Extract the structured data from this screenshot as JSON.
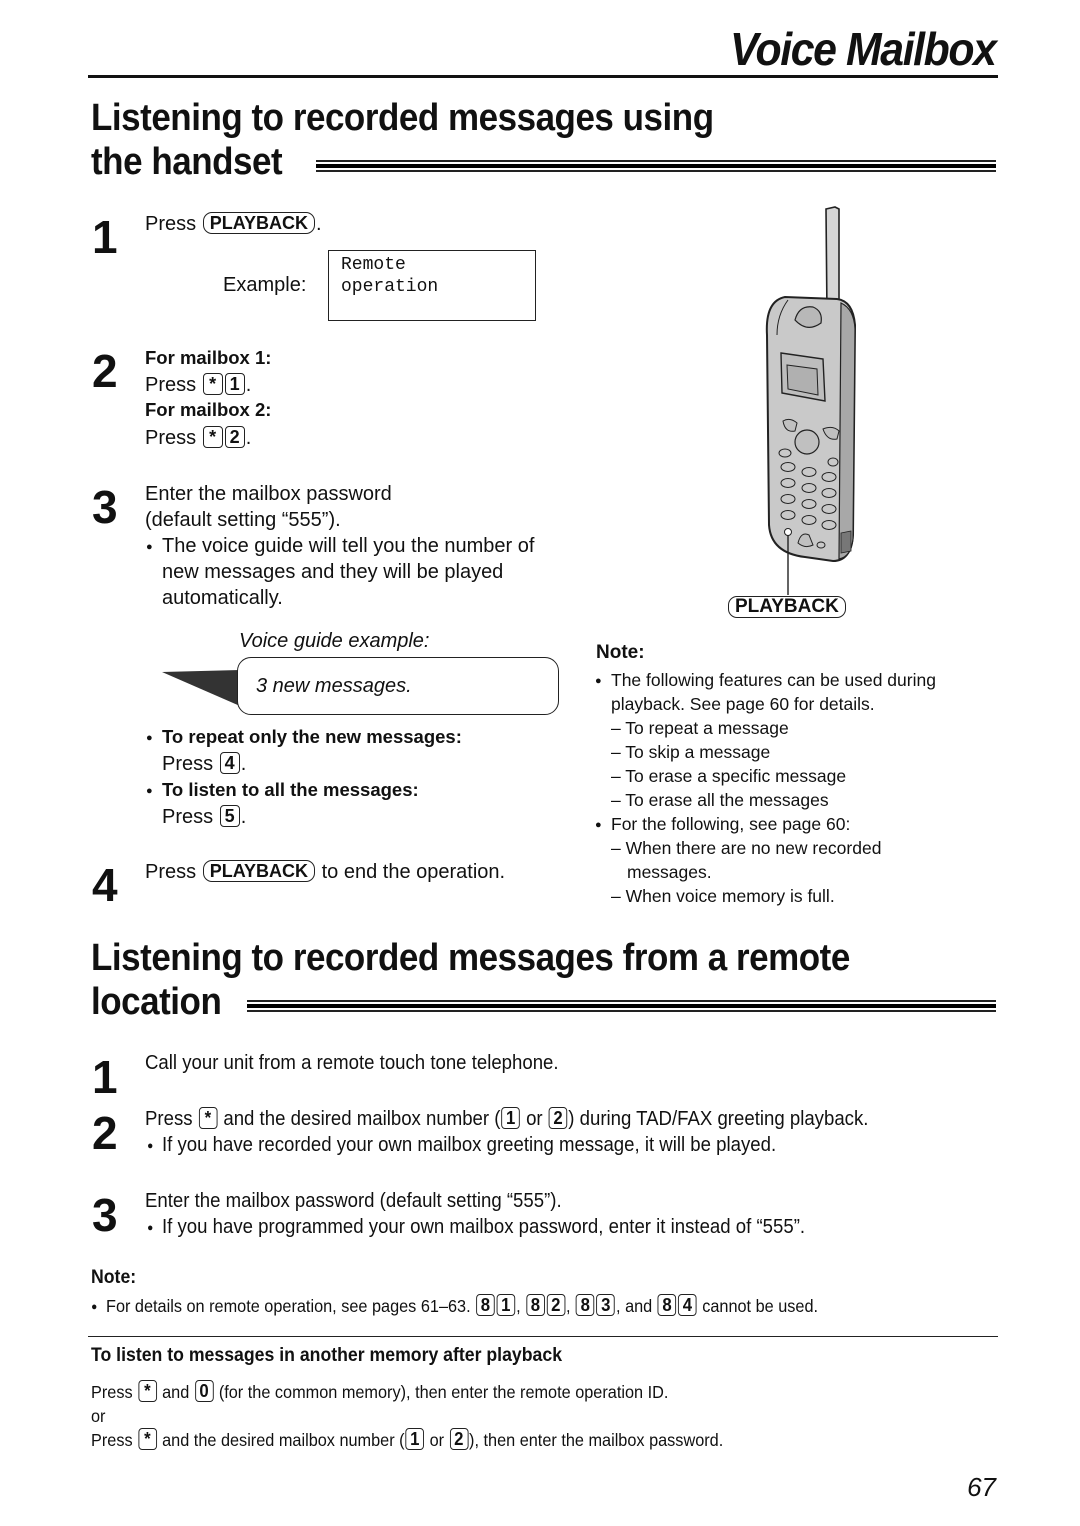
{
  "header": {
    "title": "Voice Mailbox"
  },
  "section1": {
    "title_line1": "Listening to recorded messages using",
    "title_line2": "the handset",
    "step1": {
      "number": "1",
      "press": "Press",
      "key": "PLAYBACK",
      "end": ".",
      "example_label": "Example:",
      "lcd_line1": "Remote",
      "lcd_line2": "operation"
    },
    "step2": {
      "number": "2",
      "mb1_label": "For mailbox 1:",
      "mb1_press": "Press",
      "mb1_keys": [
        "*",
        "1"
      ],
      "mb2_label": "For mailbox 2:",
      "mb2_press": "Press",
      "mb2_keys": [
        "*",
        "2"
      ],
      "end": "."
    },
    "step3": {
      "number": "3",
      "line1": "Enter the mailbox password",
      "line2": "(default setting “555”).",
      "bullet_line1": "The voice guide will tell you the number of",
      "bullet_line2": "new messages and they will be played",
      "bullet_line3": "automatically.",
      "voice_guide_label": "Voice guide example:",
      "voice_guide_text": "3 new messages.",
      "repeat_label": "To repeat only the new messages:",
      "repeat_press": "Press",
      "repeat_key": "4",
      "all_label": "To listen to all the messages:",
      "all_press": "Press",
      "all_key": "5",
      "end": "."
    },
    "step4": {
      "number": "4",
      "press": "Press",
      "key": "PLAYBACK",
      "rest": "to end the operation."
    },
    "illustration": {
      "callout_label": "PLAYBACK"
    },
    "note": {
      "title": "Note:",
      "bullet1_line1": "The following features can be used during",
      "bullet1_line2": "playback. See page 60 for details.",
      "sub_items": [
        "– To repeat a message",
        "– To skip a message",
        "– To erase a specific message",
        "– To erase all the messages"
      ],
      "bullet2": "For the following, see page 60:",
      "sub2_line1": "– When there are no new recorded",
      "sub2_line2": "messages.",
      "sub2_line3": "– When voice memory is full."
    }
  },
  "section2": {
    "title_line1": "Listening to recorded messages from a remote",
    "title_line2": "location",
    "step1": {
      "number": "1",
      "text": "Call your unit from a remote touch tone telephone."
    },
    "step2": {
      "number": "2",
      "press": "Press",
      "key_star": "*",
      "mid": "and the desired mailbox number (",
      "key1": "1",
      "or": "or",
      "key2": "2",
      "rest": ") during TAD/FAX greeting playback.",
      "bullet": "If you have recorded your own mailbox greeting message, it will be played."
    },
    "step3": {
      "number": "3",
      "text": "Enter the mailbox password (default setting “555”).",
      "bullet": "If you have programmed your own mailbox password, enter it instead of “555”."
    },
    "note": {
      "title": "Note:",
      "text_before": "For details on remote operation, see pages 61–63.",
      "key_pairs": [
        [
          "8",
          "1"
        ],
        [
          "8",
          "2"
        ],
        [
          "8",
          "3"
        ],
        [
          "8",
          "4"
        ]
      ],
      "and": "and",
      "text_after": "cannot be used."
    },
    "subsection": {
      "title": "To listen to messages in another memory after playback",
      "line1_press": "Press",
      "line1_key_star": "*",
      "line1_and": "and",
      "line1_key0": "0",
      "line1_rest": "(for the common memory), then enter the remote operation ID.",
      "or": "or",
      "line2_press": "Press",
      "line2_key_star": "*",
      "line2_mid": "and the desired mailbox number (",
      "line2_key1": "1",
      "line2_or": "or",
      "line2_key2": "2",
      "line2_rest": "), then enter the mailbox password."
    }
  },
  "footer": {
    "page_number": "67"
  }
}
